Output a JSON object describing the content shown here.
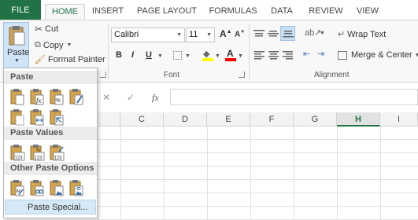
{
  "tabs": {
    "file": "FILE",
    "home": "HOME",
    "insert": "INSERT",
    "page_layout": "PAGE LAYOUT",
    "formulas": "FORMULAS",
    "data": "DATA",
    "review": "REVIEW",
    "view": "VIEW"
  },
  "clipboard": {
    "paste": "Paste",
    "cut": "Cut",
    "copy": "Copy",
    "format_painter": "Format Painter"
  },
  "font": {
    "name": "Calibri",
    "size": "11",
    "bold": "B",
    "italic": "I",
    "underline": "U",
    "grow": "A",
    "shrink": "A",
    "color_letter": "A",
    "group_label": "Font"
  },
  "alignment": {
    "wrap_text": "Wrap Text",
    "merge_center": "Merge & Center",
    "group_label": "Alignment"
  },
  "formula_bar": {
    "fx": "fx"
  },
  "columns": [
    "C",
    "D",
    "E",
    "F",
    "G",
    "H",
    "I"
  ],
  "selected_column": "H",
  "paste_menu": {
    "section_paste": "Paste",
    "section_values": "Paste Values",
    "section_other": "Other Paste Options",
    "paste_special": "Paste Special..."
  },
  "colors": {
    "accent": "#217346",
    "highlight": "#d5e8f5"
  }
}
